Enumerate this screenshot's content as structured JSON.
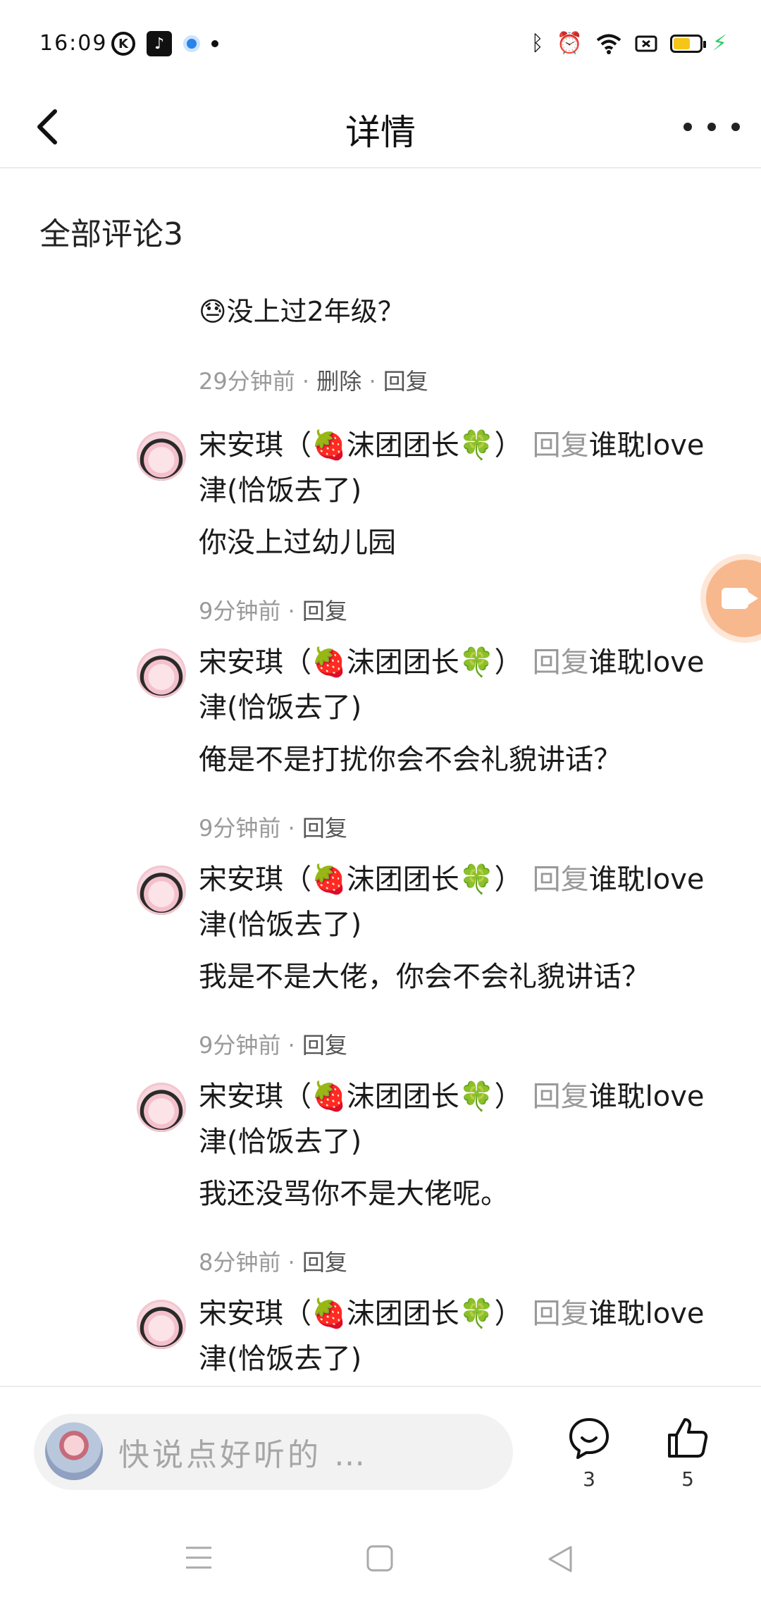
{
  "status_bar": {
    "time": "16:09",
    "left_icons": [
      "k-app-icon",
      "tiktok-icon",
      "blue-circle-icon",
      "dot-icon"
    ],
    "right_icons": [
      "bluetooth-icon",
      "alarm-icon",
      "wifi-icon",
      "screen-icon",
      "battery-icon",
      "charging-icon"
    ],
    "battery_level": 0.65
  },
  "header": {
    "title": "详情"
  },
  "comments": {
    "section_title": "全部评论3",
    "top_comment": {
      "text": "😓没上过2年级？",
      "time": "29分钟前",
      "sep": "·",
      "delete_label": "删除",
      "reply_label": "回复"
    },
    "replies": [
      {
        "author": "宋安琪（🍓沫团团长🍀）",
        "reply_word": "回复",
        "target": "谁耽love 津(恰饭去了)",
        "text": "你没上过幼儿园",
        "time": "9分钟前",
        "reply_label": "回复"
      },
      {
        "author": "宋安琪（🍓沫团团长🍀）",
        "reply_word": "回复",
        "target": "谁耽love 津(恰饭去了)",
        "text": "俺是不是打扰你会不会礼貌讲话？",
        "time": "9分钟前",
        "reply_label": "回复"
      },
      {
        "author": "宋安琪（🍓沫团团长🍀）",
        "reply_word": "回复",
        "target": "谁耽love 津(恰饭去了)",
        "text": "我是不是大佬，你会不会礼貌讲话？",
        "time": "9分钟前",
        "reply_label": "回复"
      },
      {
        "author": "宋安琪（🍓沫团团长🍀）",
        "reply_word": "回复",
        "target": "谁耽love 津(恰饭去了)",
        "text": "我还没骂你不是大佬呢。",
        "time": "8分钟前",
        "reply_label": "回复"
      },
      {
        "author": "宋安琪（🍓沫团团长🍀）",
        "reply_word": "回复",
        "target": "谁耽love 津(恰饭去了)"
      }
    ]
  },
  "input_bar": {
    "placeholder": "快说点好听的 …",
    "comment_count": "3",
    "like_count": "5"
  },
  "colors": {
    "meta_gray": "#9a9a9a",
    "fab_orange": "#f7b88d",
    "charging_green": "#31c96a",
    "battery_yellow": "#f5c518"
  }
}
